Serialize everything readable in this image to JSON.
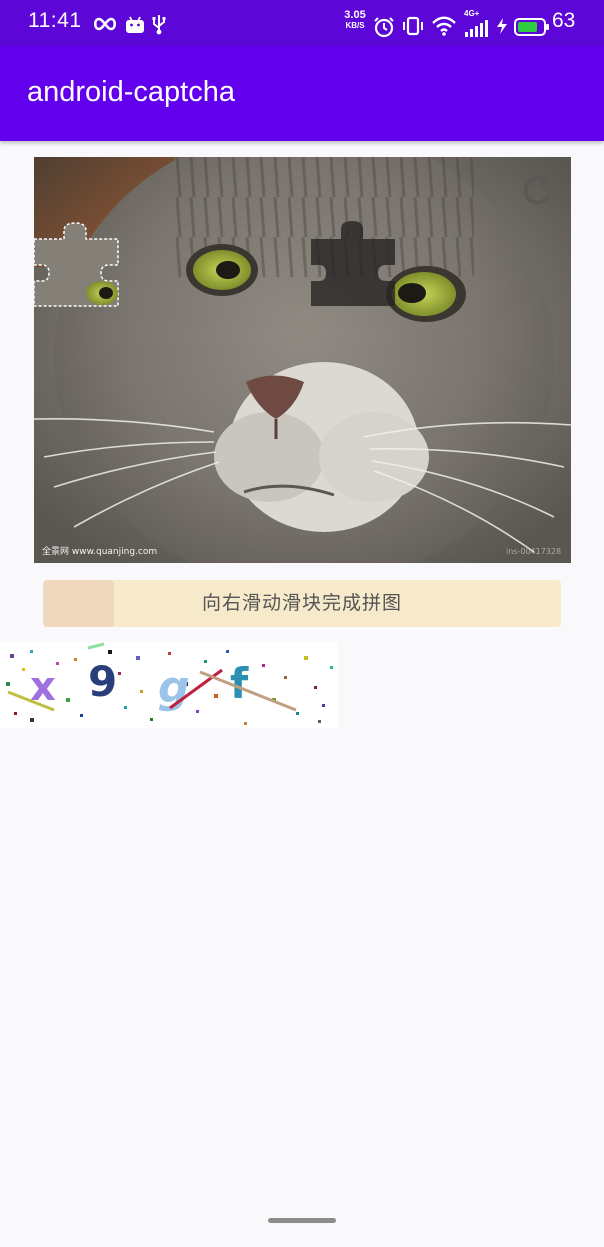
{
  "status_bar": {
    "time": "11:41",
    "net_speed_value": "3.05",
    "net_speed_unit": "KB/S",
    "network_generation": "4G+",
    "battery_percent": "63",
    "icons": [
      "infinity-icon",
      "android-icon",
      "usb-icon",
      "alarm-icon",
      "vibrate-icon",
      "wifi-icon",
      "signal-icon",
      "charging-icon",
      "battery-icon"
    ]
  },
  "app_bar": {
    "title": "android-captcha"
  },
  "puzzle": {
    "image_description": "close-up photo of a grey tabby cat",
    "watermark_left": "全景网 www.quanjing.com",
    "watermark_right": "ins-00417328",
    "refresh_icon": "refresh-icon"
  },
  "slider": {
    "hint": "向右滑动滑块完成拼图",
    "track_color": "#f7eacb",
    "thumb_color": "#f0d8bc",
    "progress": 0
  },
  "text_captcha": {
    "characters": [
      "x",
      "9",
      "g",
      "f"
    ],
    "char_colors": [
      "#a070e0",
      "#2a3f7a",
      "#9bc4ea",
      "#2a8fb0"
    ]
  },
  "colors": {
    "status_bar": "#5c06d8",
    "app_bar": "#6200ee",
    "page_background": "#f9f9fb"
  }
}
